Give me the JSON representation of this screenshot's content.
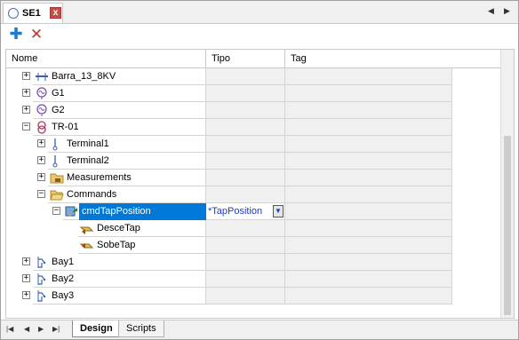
{
  "tab": {
    "title": "SE1",
    "close_glyph": "x"
  },
  "tab_scroll": {
    "left": "◀",
    "right": "▶"
  },
  "toolbar": {
    "add_glyph": "✚",
    "delete_glyph": "✕"
  },
  "columns": {
    "nome": "Nome",
    "tipo": "Tipo",
    "tag": "Tag"
  },
  "rows": [
    {
      "label": "Barra_13_8KV",
      "icon": "busbar-icon",
      "expander": "+",
      "level": 0
    },
    {
      "label": "G1",
      "icon": "generator-icon",
      "expander": "+",
      "level": 0
    },
    {
      "label": "G2",
      "icon": "generator-icon",
      "expander": "+",
      "level": 0
    },
    {
      "label": "TR-01",
      "icon": "transformer-icon",
      "expander": "−",
      "level": 0
    },
    {
      "label": "Terminal1",
      "icon": "terminal-icon",
      "expander": "+",
      "level": 1
    },
    {
      "label": "Terminal2",
      "icon": "terminal-icon",
      "expander": "+",
      "level": 1
    },
    {
      "label": "Measurements",
      "icon": "folder-icon",
      "expander": "+",
      "level": 1
    },
    {
      "label": "Commands",
      "icon": "folder-open-icon",
      "expander": "−",
      "level": 1
    },
    {
      "label": "cmdTapPosition",
      "icon": "command-icon",
      "expander": "−",
      "level": 2,
      "tipo": "*TapPosition",
      "selected": true
    },
    {
      "label": "DesceTap",
      "icon": "tap-down-icon",
      "expander": "",
      "level": 3
    },
    {
      "label": "SobeTap",
      "icon": "tap-up-icon",
      "expander": "",
      "level": 3
    },
    {
      "label": "Bay1",
      "icon": "bay-icon",
      "expander": "+",
      "level": 0
    },
    {
      "label": "Bay2",
      "icon": "bay-icon",
      "expander": "+",
      "level": 0
    },
    {
      "label": "Bay3",
      "icon": "bay-icon",
      "expander": "+",
      "level": 0
    }
  ],
  "bottom_nav": {
    "first": "|◀",
    "prev": "◀",
    "next": "▶",
    "last": "▶|"
  },
  "sheets": {
    "design": "Design",
    "scripts": "Scripts"
  },
  "colors": {
    "selection": "#0078d7",
    "accent_blue": "#1f7bd0",
    "delete_red": "#b83a32",
    "tab_close": "#c0504d"
  }
}
